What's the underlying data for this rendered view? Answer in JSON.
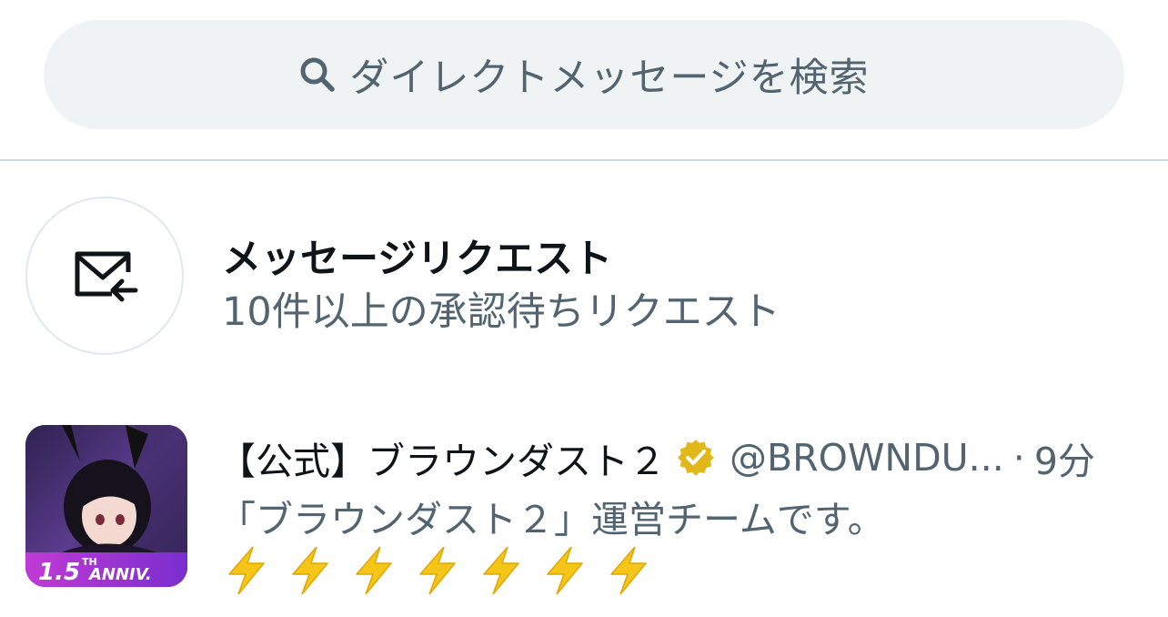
{
  "search": {
    "placeholder": "ダイレクトメッセージを検索",
    "icon": "search-icon"
  },
  "message_requests": {
    "title": "メッセージリクエスト",
    "subtitle": "10件以上の承認待ちリクエスト",
    "icon": "mail-incoming-icon"
  },
  "conversations": [
    {
      "name": "【公式】ブラウンダスト２",
      "verified": true,
      "handle": "@BROWNDU...",
      "separator": "·",
      "time": "9分",
      "message": "「ブラウンダスト２」運営チームです。",
      "emoji_row": "⚡⚡⚡⚡⚡⚡⚡",
      "avatar_badge": "1.5TH ANNIV."
    }
  ],
  "colors": {
    "primary_text": "#0f1419",
    "secondary_text": "#536471",
    "search_bg": "#eff3f4",
    "verified_gold": "#e2b719",
    "bolt": "#f5c518"
  }
}
